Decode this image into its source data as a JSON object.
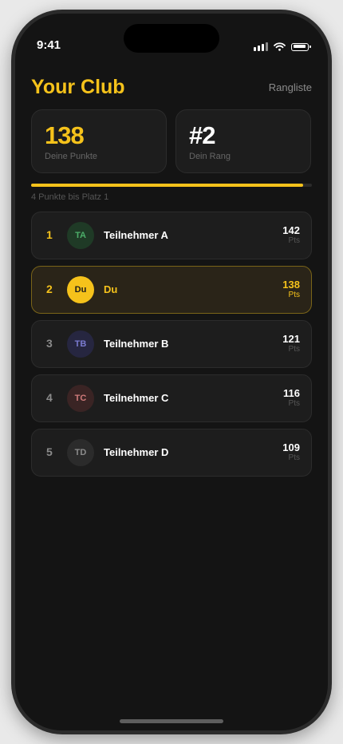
{
  "status_bar": {
    "time": "9:41"
  },
  "header": {
    "title": "Your Club",
    "link_label": "Rangliste"
  },
  "stats": {
    "points": {
      "value": "138",
      "label": "Deine Punkte"
    },
    "rank": {
      "value": "#2",
      "label": "Dein Rang"
    }
  },
  "progress": {
    "fraction": 0.97,
    "caption": "4 Punkte bis Platz 1"
  },
  "leaderboard": [
    {
      "rank": "1",
      "initials": "TA",
      "name": "Teilnehmer A",
      "points": "142",
      "unit": "Pts",
      "avatar_bg": "#1f3a26",
      "avatar_fg": "#4caf6a",
      "rank_color": "#f5c21b",
      "is_me": false
    },
    {
      "rank": "2",
      "initials": "Du",
      "name": "Du",
      "points": "138",
      "unit": "Pts",
      "avatar_bg": "#f5c21b",
      "avatar_fg": "#1a1a1a",
      "rank_color": "#f5c21b",
      "is_me": true
    },
    {
      "rank": "3",
      "initials": "TB",
      "name": "Teilnehmer B",
      "points": "121",
      "unit": "Pts",
      "avatar_bg": "#262640",
      "avatar_fg": "#7b7bd0",
      "rank_color": "#8b8b8b",
      "is_me": false
    },
    {
      "rank": "4",
      "initials": "TC",
      "name": "Teilnehmer C",
      "points": "116",
      "unit": "Pts",
      "avatar_bg": "#3a2424",
      "avatar_fg": "#d07b7b",
      "rank_color": "#8b8b8b",
      "is_me": false
    },
    {
      "rank": "5",
      "initials": "TD",
      "name": "Teilnehmer D",
      "points": "109",
      "unit": "Pts",
      "avatar_bg": "#2b2b2b",
      "avatar_fg": "#8b8b8b",
      "rank_color": "#8b8b8b",
      "is_me": false
    }
  ],
  "colors": {
    "accent": "#f5c21b",
    "background": "#141414",
    "card": "#1d1d1d"
  },
  "icons": {
    "signal": "cellular-signal-icon",
    "wifi": "wifi-icon",
    "battery": "battery-icon"
  }
}
